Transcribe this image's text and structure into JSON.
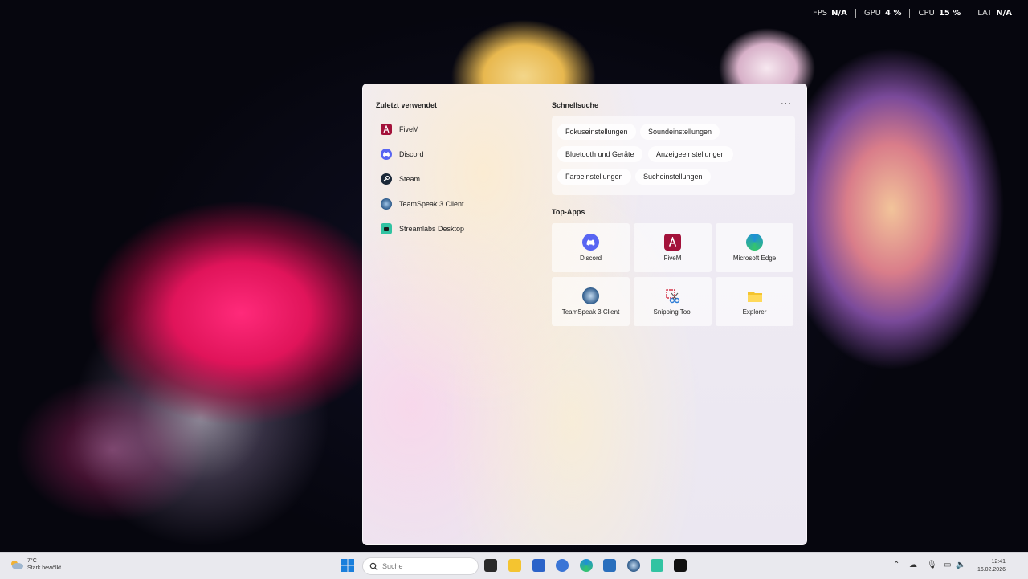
{
  "perf": [
    {
      "label": "FPS",
      "value": "N/A"
    },
    {
      "label": "GPU",
      "value": "4 %"
    },
    {
      "label": "CPU",
      "value": "15 %"
    },
    {
      "label": "LAT",
      "value": "N/A"
    }
  ],
  "start_menu": {
    "recent_title": "Zuletzt verwendet",
    "recent": [
      {
        "label": "FiveM",
        "icon": "fivem-icon",
        "color": "#a3123a"
      },
      {
        "label": "Discord",
        "icon": "discord-icon",
        "color": "#5865f2"
      },
      {
        "label": "Steam",
        "icon": "steam-icon",
        "color": "#1b2838"
      },
      {
        "label": "TeamSpeak 3 Client",
        "icon": "teamspeak-icon",
        "color": "#2d5a8a"
      },
      {
        "label": "Streamlabs Desktop",
        "icon": "streamlabs-icon",
        "color": "#31c3a2"
      }
    ],
    "quick_title": "Schnellsuche",
    "more_label": "···",
    "quick": [
      "Fokuseinstellungen",
      "Soundeinstellungen",
      "Bluetooth und Geräte",
      "Anzeigeeinstellungen",
      "Farbeinstellungen",
      "Sucheinstellungen"
    ],
    "top_title": "Top-Apps",
    "top": [
      {
        "label": "Discord",
        "icon": "discord-icon",
        "color": "#5865f2"
      },
      {
        "label": "FiveM",
        "icon": "fivem-icon",
        "color": "#a3123a"
      },
      {
        "label": "Microsoft Edge",
        "icon": "edge-icon",
        "color": "#1f8fd6"
      },
      {
        "label": "TeamSpeak 3 Client",
        "icon": "teamspeak-icon",
        "color": "#2d5a8a"
      },
      {
        "label": "Snipping Tool",
        "icon": "snipping-tool-icon",
        "color": "#d6364b"
      },
      {
        "label": "Explorer",
        "icon": "folder-icon",
        "color": "#f4c430"
      }
    ]
  },
  "taskbar": {
    "weather_temp": "7°C",
    "weather_desc": "Stark bewölkt",
    "search_placeholder": "Suche",
    "time": "12:41",
    "date": "16.02.2026"
  }
}
